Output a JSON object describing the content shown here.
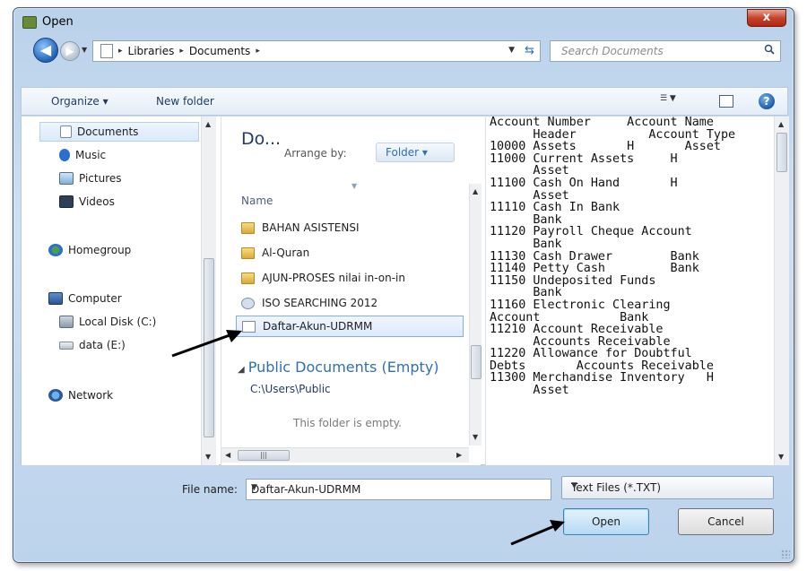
{
  "window": {
    "title": "Open",
    "close_glyph": "x"
  },
  "address": {
    "crumbs": [
      "Libraries",
      "Documents"
    ],
    "sep": "▸"
  },
  "search": {
    "placeholder": "Search Documents"
  },
  "toolbar": {
    "organize_label": "Organize ▾",
    "new_folder_label": "New folder"
  },
  "sidebar": {
    "items": [
      {
        "label": "Documents",
        "icon": "documents-icon",
        "selected": true
      },
      {
        "label": "Music",
        "icon": "music-icon"
      },
      {
        "label": "Pictures",
        "icon": "pictures-icon"
      },
      {
        "label": "Videos",
        "icon": "videos-icon"
      },
      {
        "label": "Homegroup",
        "icon": "homegroup-icon"
      },
      {
        "label": "Computer",
        "icon": "computer-icon"
      },
      {
        "label": "Local Disk (C:)",
        "icon": "local-disk-icon"
      },
      {
        "label": "data (E:)",
        "icon": "drive-icon"
      },
      {
        "label": "Network",
        "icon": "network-icon"
      }
    ]
  },
  "library": {
    "title": "Do...",
    "arrange_label": "Arrange by:",
    "arrange_value": "Folder ▾",
    "column_name": "Name",
    "files": [
      {
        "name": "BAHAN ASISTENSI",
        "icon": "folder-icon"
      },
      {
        "name": "Al-Quran",
        "icon": "folder-icon"
      },
      {
        "name": "AJUN-PROSES nilai in-on-in",
        "icon": "folder-icon"
      },
      {
        "name": "ISO SEARCHING 2012",
        "icon": "iso-icon"
      },
      {
        "name": "Daftar-Akun-UDRMM",
        "icon": "text-file-icon",
        "selected": true
      }
    ],
    "public_heading": "Public Documents (Empty)",
    "public_path": "C:\\Users\\Public",
    "empty_message": "This folder is empty."
  },
  "preview": {
    "lines": [
      "Account Number     Account Name",
      "      Header          Account Type",
      "10000 Assets       H       Asset",
      "11000 Current Assets     H",
      "      Asset",
      "11100 Cash On Hand       H",
      "      Asset",
      "11110 Cash In Bank",
      "      Bank",
      "11120 Payroll Cheque Account",
      "      Bank",
      "11130 Cash Drawer        Bank",
      "11140 Petty Cash         Bank",
      "11150 Undeposited Funds",
      "      Bank",
      "11160 Electronic Clearing",
      "Account           Bank",
      "11210 Account Receivable",
      "      Accounts Receivable",
      "11220 Allowance for Doubtful",
      "Debts       Accounts Receivable",
      "11300 Merchandise Inventory   H",
      "      Asset"
    ]
  },
  "footer": {
    "file_name_label": "File name:",
    "file_name_value": "Daftar-Akun-UDRMM",
    "filter_value": "Text Files (*.TXT)",
    "open_label": "Open",
    "cancel_label": "Cancel"
  },
  "colors": {
    "accent": "#2f6fb5",
    "selection": "#dce9fb",
    "close": "#c7432c"
  }
}
